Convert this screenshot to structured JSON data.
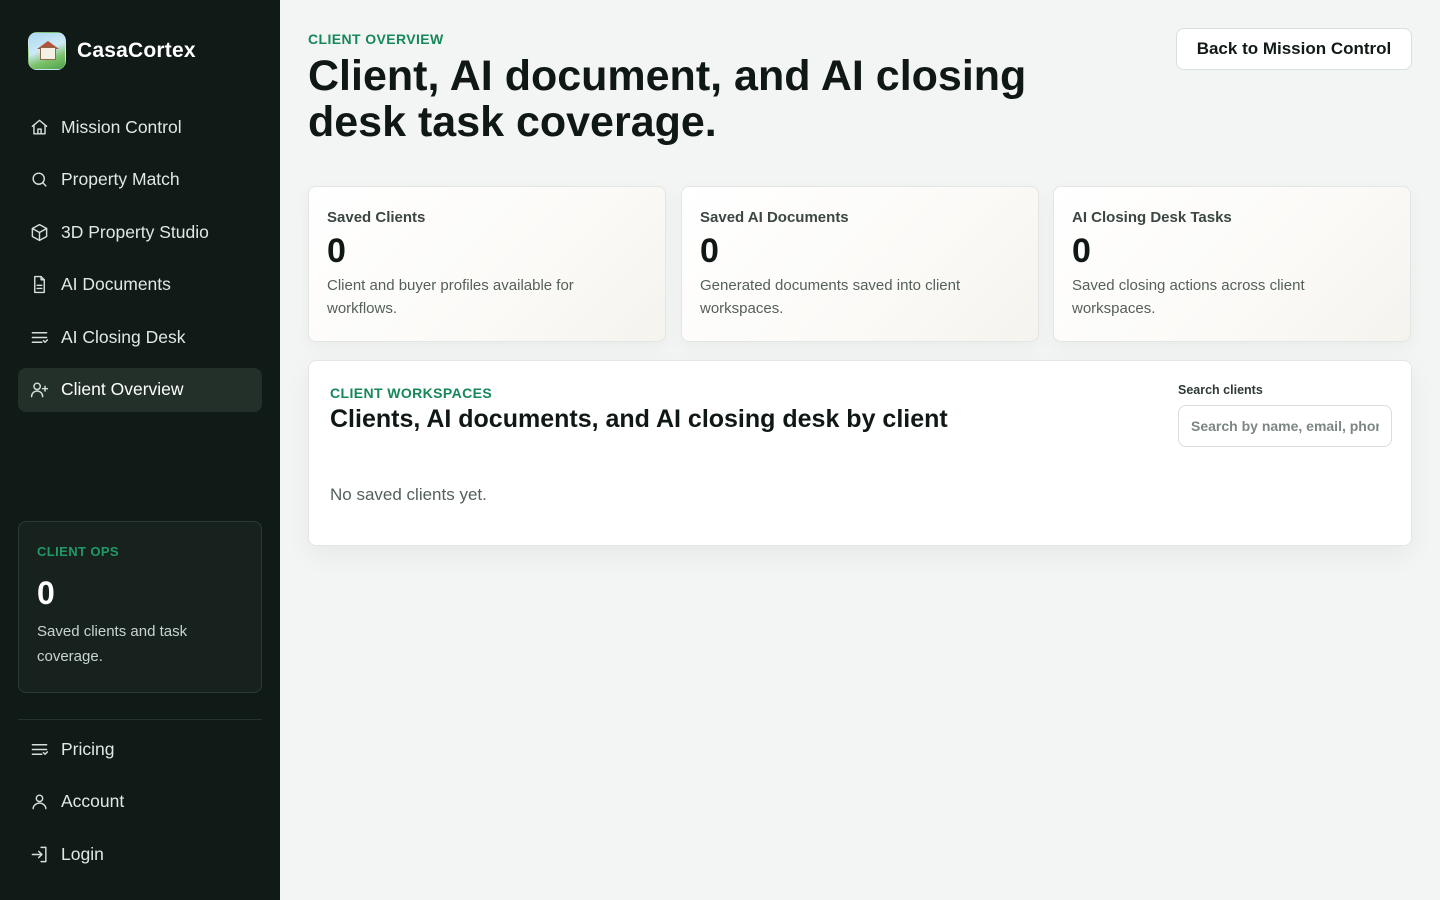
{
  "app": {
    "name": "CasaCortex"
  },
  "sidebar": {
    "nav": [
      {
        "label": "Mission Control",
        "icon": "home-icon"
      },
      {
        "label": "Property Match",
        "icon": "search-icon"
      },
      {
        "label": "3D Property Studio",
        "icon": "cube-icon"
      },
      {
        "label": "AI Documents",
        "icon": "document-icon"
      },
      {
        "label": "AI Closing Desk",
        "icon": "list-icon"
      },
      {
        "label": "Client Overview",
        "icon": "user-plus-icon",
        "active": true
      }
    ],
    "ops": {
      "label": "CLIENT OPS",
      "value": "0",
      "description": "Saved clients and task coverage."
    },
    "bottom_nav": [
      {
        "label": "Pricing",
        "icon": "list-icon"
      },
      {
        "label": "Account",
        "icon": "user-icon"
      },
      {
        "label": "Login",
        "icon": "login-icon"
      }
    ]
  },
  "header": {
    "kicker": "CLIENT OVERVIEW",
    "title": "Client, AI document, and AI closing desk task coverage.",
    "back_button": "Back to Mission Control"
  },
  "stats": [
    {
      "label": "Saved Clients",
      "value": "0",
      "description": "Client and buyer profiles available for workflows."
    },
    {
      "label": "Saved AI Documents",
      "value": "0",
      "description": "Generated documents saved into client workspaces."
    },
    {
      "label": "AI Closing Desk Tasks",
      "value": "0",
      "description": "Saved closing actions across client workspaces."
    }
  ],
  "workspace": {
    "kicker": "CLIENT WORKSPACES",
    "title": "Clients, AI documents, and AI closing desk by client",
    "search_label": "Search clients",
    "search_placeholder": "Search by name, email, phone",
    "search_value": "",
    "empty_text": "No saved clients yet."
  },
  "colors": {
    "sidebar_bg": "#101a17",
    "accent_green": "#16875a",
    "page_bg": "#f3f5f4"
  }
}
